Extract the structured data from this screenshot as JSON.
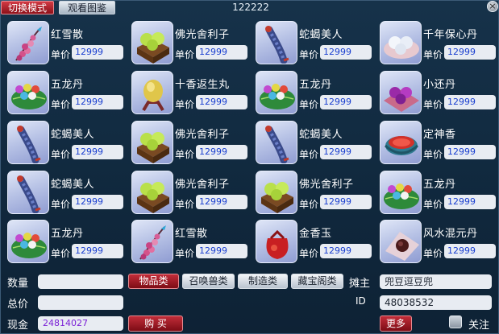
{
  "topbar": {
    "switch_mode": "切换模式",
    "view_catalog": "观看图鉴",
    "title": "122222",
    "close": "×"
  },
  "items": [
    {
      "name": "红雪散",
      "price_label": "单价",
      "price": "12999",
      "icon": "red-berry-branch-icon"
    },
    {
      "name": "佛光舍利子",
      "price_label": "单价",
      "price": "12999",
      "icon": "green-pearls-box-icon"
    },
    {
      "name": "蛇蝎美人",
      "price_label": "单价",
      "price": "12999",
      "icon": "scorpion-icon"
    },
    {
      "name": "千年保心丹",
      "price_label": "单价",
      "price": "12999",
      "icon": "white-pills-plate-icon"
    },
    {
      "name": "五龙丹",
      "price_label": "单价",
      "price": "12999",
      "icon": "colored-pills-leaf-icon"
    },
    {
      "name": "十香返生丸",
      "price_label": "单价",
      "price": "12999",
      "icon": "golden-orb-stand-icon"
    },
    {
      "name": "五龙丹",
      "price_label": "单价",
      "price": "12999",
      "icon": "colored-pills-leaf-icon"
    },
    {
      "name": "小还丹",
      "price_label": "单价",
      "price": "12999",
      "icon": "purple-pills-cloth-icon"
    },
    {
      "name": "蛇蝎美人",
      "price_label": "单价",
      "price": "12999",
      "icon": "scorpion-icon"
    },
    {
      "name": "佛光舍利子",
      "price_label": "单价",
      "price": "12999",
      "icon": "green-pearls-box-icon"
    },
    {
      "name": "蛇蝎美人",
      "price_label": "单价",
      "price": "12999",
      "icon": "scorpion-icon"
    },
    {
      "name": "定神香",
      "price_label": "单价",
      "price": "12999",
      "icon": "incense-bowl-icon"
    },
    {
      "name": "蛇蝎美人",
      "price_label": "单价",
      "price": "12999",
      "icon": "scorpion-icon"
    },
    {
      "name": "佛光舍利子",
      "price_label": "单价",
      "price": "12999",
      "icon": "green-pearls-box-icon"
    },
    {
      "name": "佛光舍利子",
      "price_label": "单价",
      "price": "12999",
      "icon": "green-pearls-box-icon"
    },
    {
      "name": "五龙丹",
      "price_label": "单价",
      "price": "12999",
      "icon": "colored-pills-leaf-icon"
    },
    {
      "name": "五龙丹",
      "price_label": "单价",
      "price": "12999",
      "icon": "colored-pills-leaf-icon"
    },
    {
      "name": "红雪散",
      "price_label": "单价",
      "price": "12999",
      "icon": "red-berry-branch-icon"
    },
    {
      "name": "金香玉",
      "price_label": "单价",
      "price": "12999",
      "icon": "red-pouch-icon"
    },
    {
      "name": "风水混元丹",
      "price_label": "单价",
      "price": "12999",
      "icon": "dark-pill-cloth-icon"
    }
  ],
  "bottom": {
    "quantity_label": "数量",
    "quantity_value": "",
    "total_label": "总价",
    "total_value": "",
    "cash_label": "现金",
    "cash_value": "24814027",
    "buy_button": "购 买",
    "categories": [
      {
        "label": "物品类",
        "active": true
      },
      {
        "label": "召唤兽类",
        "active": false
      },
      {
        "label": "制造类",
        "active": false
      },
      {
        "label": "藏宝阁类",
        "active": false
      }
    ],
    "owner_label": "摊主",
    "owner_value": "兜豆逗豆兜",
    "id_label": "ID",
    "id_value": "48038532",
    "more_button": "更多",
    "follow_label": "关注"
  },
  "colors": {
    "background": "#10283d",
    "price_text": "#1a3fd0",
    "cash_text": "#7a1fd6",
    "active_red": "#c22d39"
  }
}
